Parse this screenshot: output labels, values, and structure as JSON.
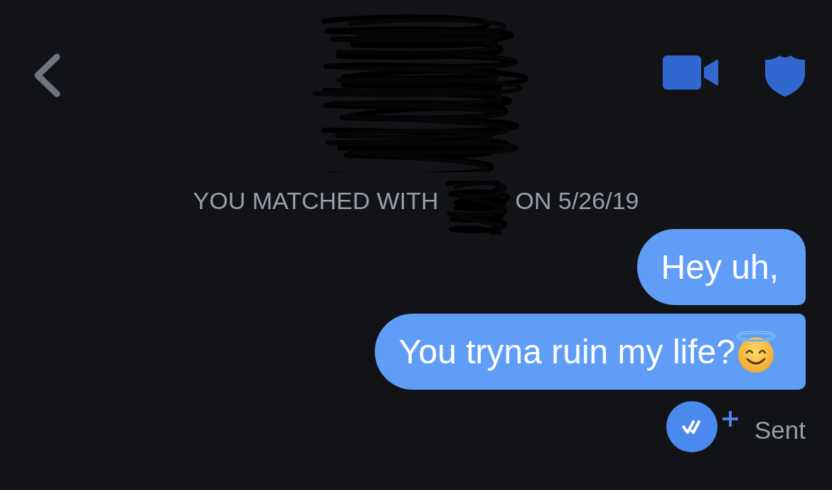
{
  "match_notice": {
    "before": "YOU MATCHED WITH",
    "after": "ON 5/26/19"
  },
  "messages": [
    {
      "kind": "plain",
      "text": "Hey uh,"
    },
    {
      "kind": "emoji",
      "text": "You tryna ruin my life?"
    }
  ],
  "receipt": {
    "label": "Sent"
  }
}
